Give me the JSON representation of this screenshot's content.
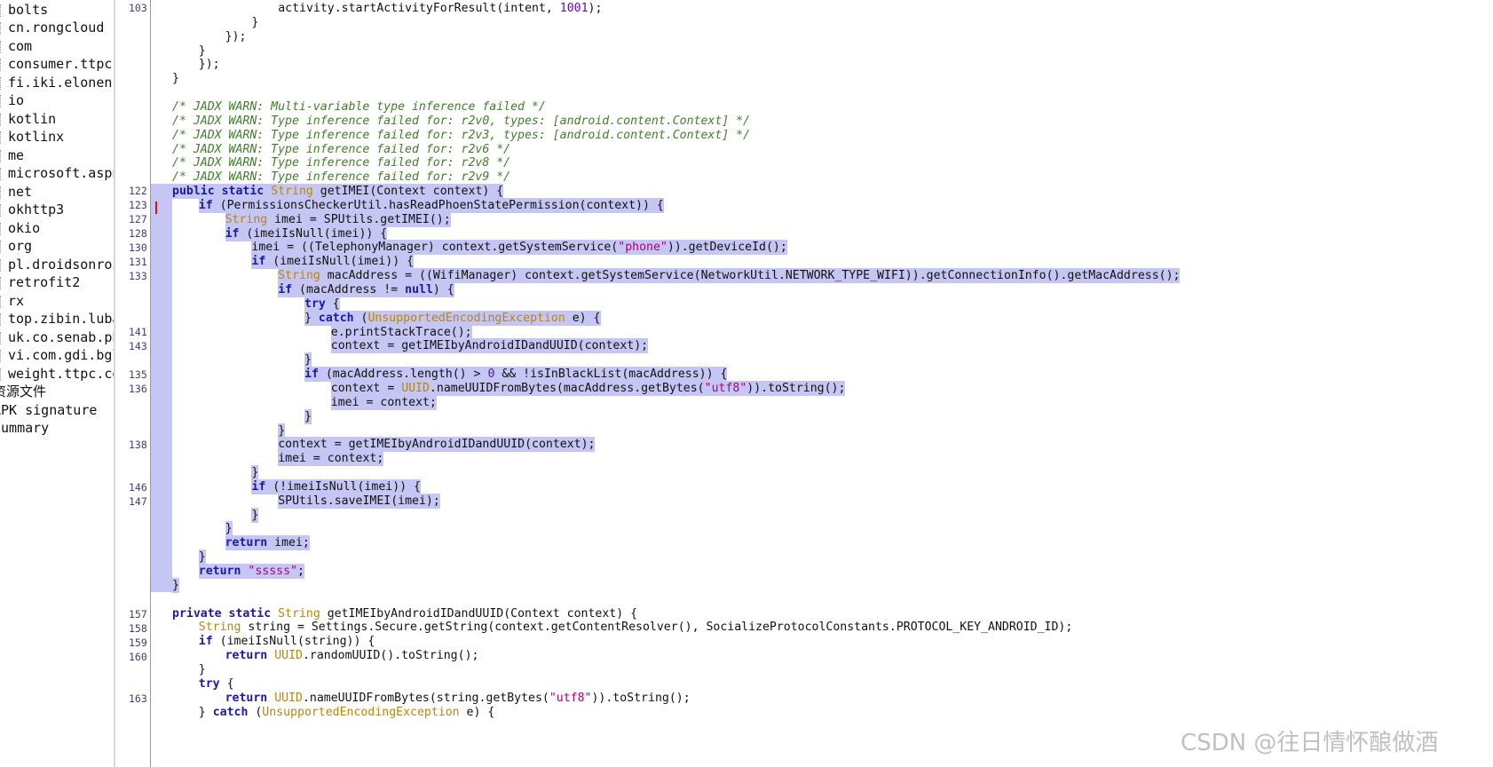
{
  "tree": {
    "items": [
      "bolts",
      "cn.rongcloud",
      "com",
      "consumer.ttpc.",
      "fi.iki.elonen",
      "io",
      "kotlin",
      "kotlinx",
      "me",
      "microsoft.aspn",
      "net",
      "okhttp3",
      "okio",
      "org",
      "pl.droidsonroi",
      "retrofit2",
      "rx",
      "top.zibin.luba",
      "uk.co.senab.ph",
      "vi.com.gdi.bgl",
      "weight.ttpc.co"
    ],
    "extra": [
      "资源文件",
      "APK signature",
      "Summary"
    ]
  },
  "gutter": {
    "line_numbers": [
      "103",
      "122",
      "123",
      "127",
      "128",
      "130",
      "131",
      "133",
      "141",
      "143",
      "135",
      "136",
      "138",
      "146",
      "147",
      "157",
      "158",
      "159",
      "160",
      "163"
    ]
  },
  "code": {
    "lines": [
      {
        "text": "                activity.startActivityForResult(intent, 1001);"
      },
      {
        "text": "            }"
      },
      {
        "text": "        });"
      },
      {
        "text": "    }"
      },
      {
        "text": "    });"
      },
      {
        "text": "}"
      },
      {
        "text": ""
      },
      {
        "text": "/* JADX WARN: Multi-variable type inference failed */"
      },
      {
        "text": "/* JADX WARN: Type inference failed for: r2v0, types: [android.content.Context] */"
      },
      {
        "text": "/* JADX WARN: Type inference failed for: r2v3, types: [android.content.Context] */"
      },
      {
        "text": "/* JADX WARN: Type inference failed for: r2v6 */"
      },
      {
        "text": "/* JADX WARN: Type inference failed for: r2v8 */"
      },
      {
        "text": "/* JADX WARN: Type inference failed for: r2v9 */"
      },
      {
        "text": "public static String getIMEI(Context context) {"
      },
      {
        "text": "    if (PermissionsCheckerUtil.hasReadPhoenStatePermission(context)) {"
      },
      {
        "text": "        String imei = SPUtils.getIMEI();"
      },
      {
        "text": "        if (imeiIsNull(imei)) {"
      },
      {
        "text": "            imei = ((TelephonyManager) context.getSystemService(\"phone\")).getDeviceId();"
      },
      {
        "text": "            if (imeiIsNull(imei)) {"
      },
      {
        "text": "                String macAddress = ((WifiManager) context.getSystemService(NetworkUtil.NETWORK_TYPE_WIFI)).getConnectionInfo().getMacAddress();"
      },
      {
        "text": "                if (macAddress != null) {"
      },
      {
        "text": "                    try {"
      },
      {
        "text": "                    } catch (UnsupportedEncodingException e) {"
      },
      {
        "text": "                        e.printStackTrace();"
      },
      {
        "text": "                        context = getIMEIbyAndroidIDandUUID(context);"
      },
      {
        "text": "                    }"
      },
      {
        "text": "                    if (macAddress.length() > 0 && !isInBlackList(macAddress)) {"
      },
      {
        "text": "                        context = UUID.nameUUIDFromBytes(macAddress.getBytes(\"utf8\")).toString();"
      },
      {
        "text": "                        imei = context;"
      },
      {
        "text": "                    }"
      },
      {
        "text": "                }"
      },
      {
        "text": "                context = getIMEIbyAndroidIDandUUID(context);"
      },
      {
        "text": "                imei = context;"
      },
      {
        "text": "            }"
      },
      {
        "text": "            if (!imeiIsNull(imei)) {"
      },
      {
        "text": "                SPUtils.saveIMEI(imei);"
      },
      {
        "text": "            }"
      },
      {
        "text": "        }"
      },
      {
        "text": "        return imei;"
      },
      {
        "text": "    }"
      },
      {
        "text": "    return \"sssss\";"
      },
      {
        "text": "}"
      },
      {
        "text": ""
      },
      {
        "text": "private static String getIMEIbyAndroidIDandUUID(Context context) {"
      },
      {
        "text": "    String string = Settings.Secure.getString(context.getContentResolver(), SocializeProtocolConstants.PROTOCOL_KEY_ANDROID_ID);"
      },
      {
        "text": "    if (imeiIsNull(string)) {"
      },
      {
        "text": "        return UUID.randomUUID().toString();"
      },
      {
        "text": "    }"
      },
      {
        "text": "    try {"
      },
      {
        "text": "        return UUID.nameUUIDFromBytes(string.getBytes(\"utf8\")).toString();"
      },
      {
        "text": "    } catch (UnsupportedEncodingException e) {"
      }
    ]
  },
  "watermark": {
    "text": "CSDN @往日情怀酿做酒"
  },
  "colors": {
    "selection": "#c6c6f4",
    "keyword": "#1a1aa6",
    "comment": "#3f7f2a",
    "type": "#b8860b",
    "string": "#b00070",
    "gutter_line": "#74b86a"
  }
}
